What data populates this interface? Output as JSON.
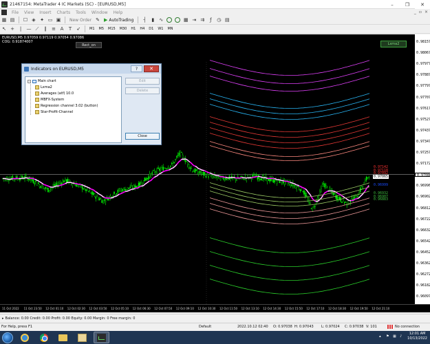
{
  "window": {
    "title": "21467154: MetaTrader 4 IC Markets (SC) - [EURUSD,M5]",
    "controls": [
      "–",
      "❐",
      "✕"
    ]
  },
  "menu": {
    "items": [
      "File",
      "View",
      "Insert",
      "Charts",
      "Tools",
      "Window",
      "Help"
    ],
    "doc_controls": [
      "_",
      "▫",
      "×"
    ]
  },
  "toolbar": {
    "new_order": "New Order",
    "autotrading": "AutoTrading",
    "timeframes": [
      "M1",
      "M5",
      "M15",
      "M30",
      "H1",
      "H4",
      "D1",
      "W1",
      "MN"
    ]
  },
  "chart": {
    "info_line1": "EURUSD,M5  0.97059 0.97119 0.97054 0.97086",
    "info_line2": "COG: 0.91874007",
    "rect_button": "Rect_on",
    "lxma_button": "Lxma2",
    "background_color": "#000000",
    "candle_color": "#00ff00",
    "ma_color": "#ffffff",
    "ma_color_alt": "#ff00ff",
    "price_labels": [
      "0.98157",
      "0.98067",
      "0.97977",
      "0.97887",
      "0.97797",
      "0.97707",
      "0.97617",
      "0.97527",
      "0.97437",
      "0.97347",
      "0.97257",
      "0.97172",
      "0.97086",
      "0.96996",
      "0.96902",
      "0.96812",
      "0.96722",
      "0.96632",
      "0.96542",
      "0.96452",
      "0.96362",
      "0.96272",
      "0.96182",
      "0.96097"
    ],
    "current_price": "0.97086",
    "right_labels": [
      {
        "text": "0.97142",
        "color": "#ff3333"
      },
      {
        "text": "0.97118",
        "color": "#ff3333"
      },
      {
        "text": "0.97092",
        "color": "#ff3333"
      },
      {
        "text": "0.97065",
        "color": "#ffffff"
      },
      {
        "text": "0.96999",
        "color": "#1a4dff"
      },
      {
        "text": "0.96932",
        "color": "#3fbf3f"
      },
      {
        "text": "0.96907",
        "color": "#3fbf3f"
      },
      {
        "text": "0.96883",
        "color": "#3fbf3f"
      }
    ],
    "time_labels": [
      "11 Oct 2022",
      "11 Oct 23:50",
      "12 Oct 01:10",
      "12 Oct 02:30",
      "12 Oct 03:50",
      "12 Oct 05:10",
      "12 Oct 06:30",
      "12 Oct 07:50",
      "12 Oct 09:10",
      "12 Oct 10:30",
      "12 Oct 11:50",
      "12 Oct 13:10",
      "12 Oct 14:30",
      "12 Oct 15:50",
      "12 Oct 17:10",
      "12 Oct 18:30",
      "12 Oct 19:50",
      "12 Oct 21:10"
    ]
  },
  "dialog": {
    "title": "Indicators on EURUSD,M5",
    "help": "?",
    "close_x": "✕",
    "root": "Main chart",
    "items": [
      "Lxma2",
      "Averages (atf) 10.0",
      "MBFX-System",
      "Regression channel 3.02 (button)",
      "Star-Profit-Channel"
    ],
    "edit": "Edit",
    "delete": "Delete",
    "close": "Close"
  },
  "terminal": {
    "text": "Balance: 0.00  Credit: 0.00  Profit: 0.00  Equity: 0.00  Margin: 0  Free margin: 0"
  },
  "status": {
    "help": "For Help, press F1",
    "profile": "Default",
    "datetime": "2022.10.12 02:40",
    "open": "O: 0.97038",
    "high": "H: 0.97043",
    "low": "L: 0.97024",
    "close": "C: 0.97038",
    "volume": "V: 101",
    "connection": "No connection"
  },
  "taskbar": {
    "time": "12:01 AM",
    "date": "10/13/2022"
  }
}
